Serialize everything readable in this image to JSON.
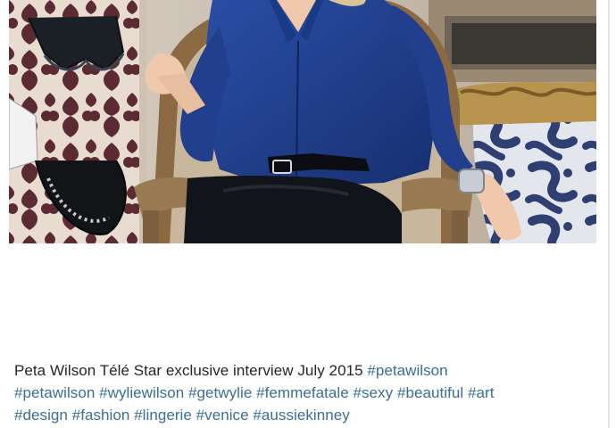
{
  "post": {
    "photo_alt": "photo",
    "caption": {
      "text": "Peta Wilson Télé Star exclusive interview July 2015",
      "hashtags": [
        "#petawilson",
        "#petawilson",
        "#wyliewilson",
        "#getwylie",
        "#femmefatale",
        "#sexy",
        "#beautiful",
        "#art",
        "#design",
        "#fashion",
        "#lingerie",
        "#venice",
        "#aussiekinney"
      ]
    }
  },
  "colors": {
    "caption_text": "#262626",
    "hashtag": "#3a6d99",
    "shirt": "#1f3f8f"
  }
}
